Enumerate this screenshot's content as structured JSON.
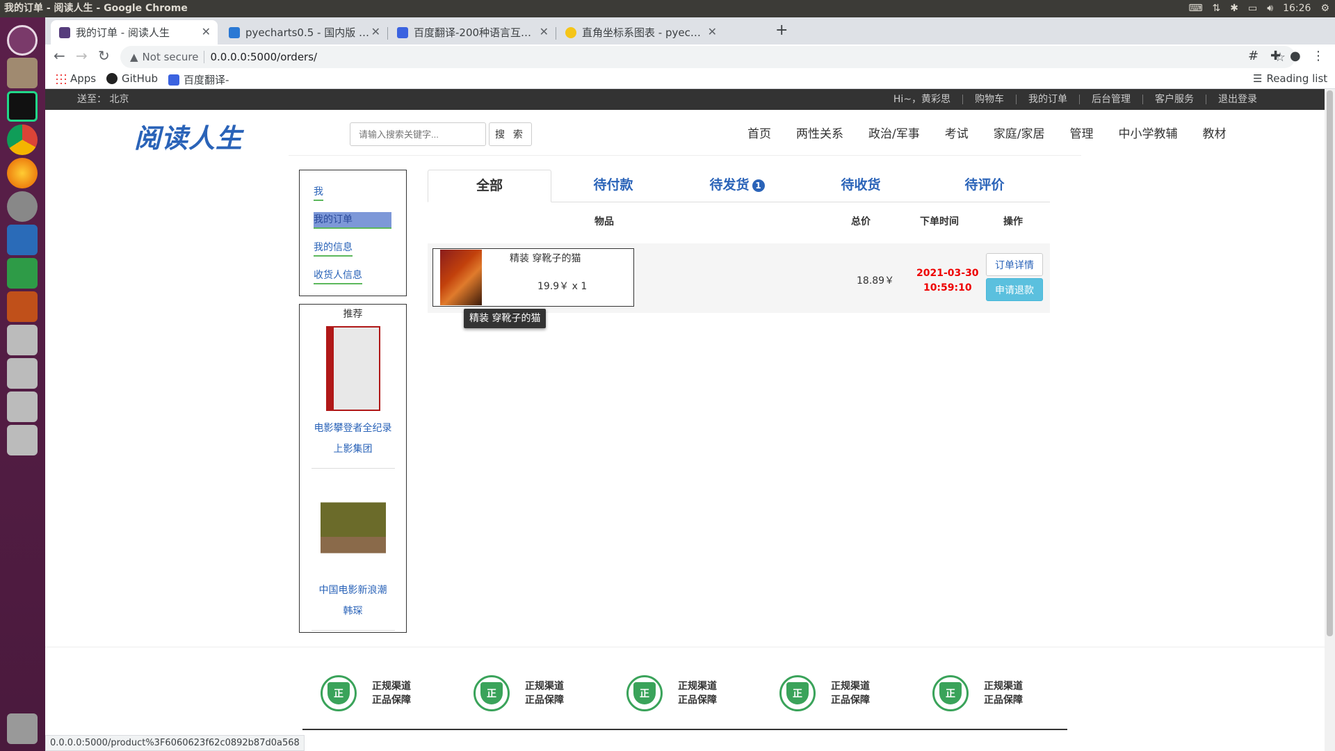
{
  "os": {
    "window_title": "我的订单 - 阅读人生 - Google Chrome",
    "clock": "16:26"
  },
  "browser": {
    "tabs": [
      {
        "label": "我的订单 - 阅读人生",
        "active": true
      },
      {
        "label": "pyecharts0.5 - 国内版 Bing"
      },
      {
        "label": "百度翻译-200种语言互译、"
      },
      {
        "label": "直角坐标系图表 - pyecharts"
      }
    ],
    "security_label": "Not secure",
    "url": "0.0.0.0:5000/orders/",
    "bookmarks": [
      "Apps",
      "GitHub",
      "百度翻译-"
    ],
    "reading_list": "Reading list",
    "status_url": "0.0.0.0:5000/product%3F6060623f62c0892b87d0a568"
  },
  "site": {
    "deliver_to": "送至：  北京",
    "top_links": [
      "Hi~，黄彩思",
      "购物车",
      "我的订单",
      "后台管理",
      "客户服务",
      "退出登录"
    ],
    "logo_text": "阅读人生",
    "search_placeholder": "请输入搜索关键字...",
    "search_button": "搜 索",
    "nav": [
      "首页",
      "两性关系",
      "政治/军事",
      "考试",
      "家庭/家居",
      "管理",
      "中小学教辅",
      "教材"
    ]
  },
  "sidebar": {
    "items": [
      "我",
      "我的订单",
      "我的信息",
      "收货人信息"
    ],
    "recommend_title": "推荐",
    "recommendations": [
      {
        "title": "电影攀登者全纪录",
        "publisher": "上影集团"
      },
      {
        "title": "中国电影新浪潮",
        "publisher": "韩琛"
      }
    ]
  },
  "orders": {
    "tabs": [
      "全部",
      "待付款",
      "待发货",
      "待收货",
      "待评价"
    ],
    "pending_ship_badge": "1",
    "headers": {
      "item": "物品",
      "total": "总价",
      "time": "下单时间",
      "action": "操作"
    },
    "rows": [
      {
        "name": "精装 穿靴子的猫",
        "unit_price": "19.9￥",
        "qty": "x 1",
        "total": "18.89￥",
        "date": "2021-03-30",
        "time": "10:59:10",
        "detail_button": "订单详情",
        "refund_button": "申请退款"
      }
    ],
    "tooltip": "精装 穿靴子的猫"
  },
  "footer": {
    "badge_glyph": "正",
    "guarantees": [
      {
        "line1": "正规渠道",
        "line2": "正品保障"
      },
      {
        "line1": "正规渠道",
        "line2": "正品保障"
      },
      {
        "line1": "正规渠道",
        "line2": "正品保障"
      },
      {
        "line1": "正规渠道",
        "line2": "正品保障"
      },
      {
        "line1": "正规渠道",
        "line2": "正品保障"
      }
    ]
  }
}
